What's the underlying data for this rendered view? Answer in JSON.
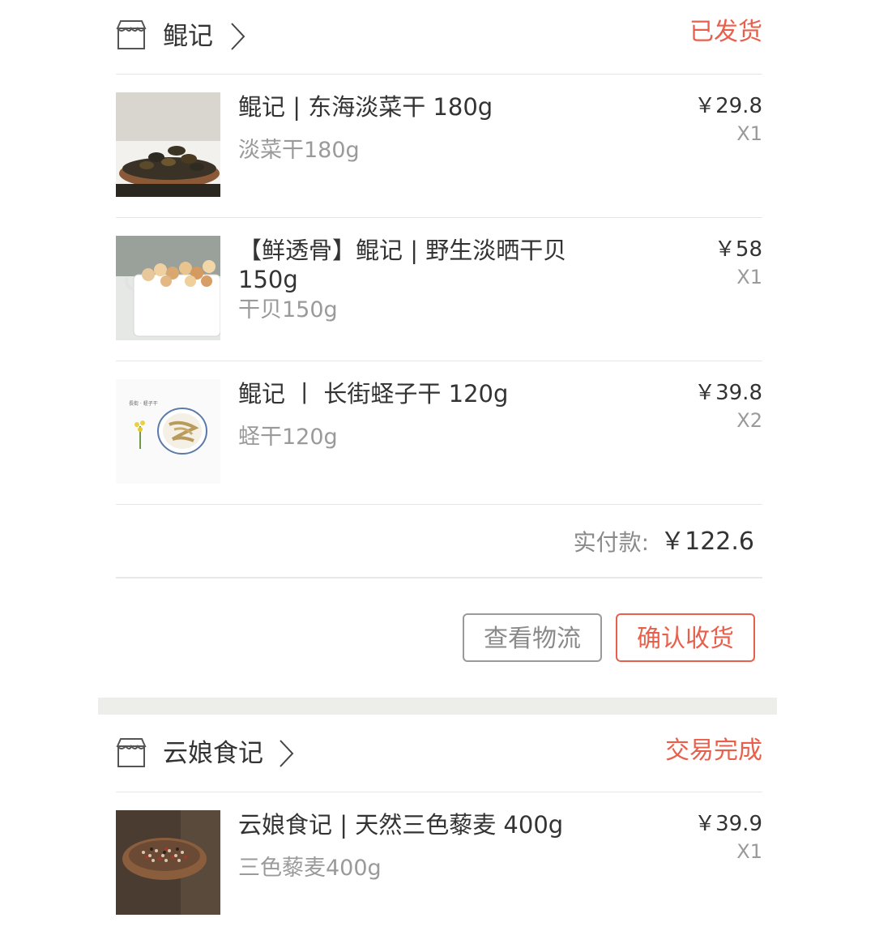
{
  "orders": [
    {
      "shop_name": "鲲记",
      "status": "已发货",
      "items": [
        {
          "title": "鲲记 | 东海淡菜干 180g",
          "spec": "淡菜干180g",
          "price": "￥29.8",
          "qty": "X1"
        },
        {
          "title": "【鲜透骨】鲲记 | 野生淡晒干贝 150g",
          "spec": "干贝150g",
          "price": "￥58",
          "qty": "X1"
        },
        {
          "title": "鲲记 丨 长街蛏子干 120g",
          "spec": "蛏干120g",
          "price": "￥39.8",
          "qty": "X2"
        }
      ],
      "total_label": "实付款:",
      "total_value": "￥122.6",
      "buttons": {
        "logistics": "查看物流",
        "confirm": "确认收货"
      }
    },
    {
      "shop_name": "云娘食记",
      "status": "交易完成",
      "items": [
        {
          "title": "云娘食记 | 天然三色藜麦 400g",
          "spec": "三色藜麦400g",
          "price": "￥39.9",
          "qty": "X1"
        }
      ]
    }
  ],
  "colors": {
    "accent": "#e8604c",
    "muted": "#9a9a9a",
    "text": "#333333",
    "divider": "#e6e6e6",
    "band": "#ededea"
  },
  "icons": {
    "shop": "storefront-icon",
    "arrow": "chevron-right-icon"
  }
}
